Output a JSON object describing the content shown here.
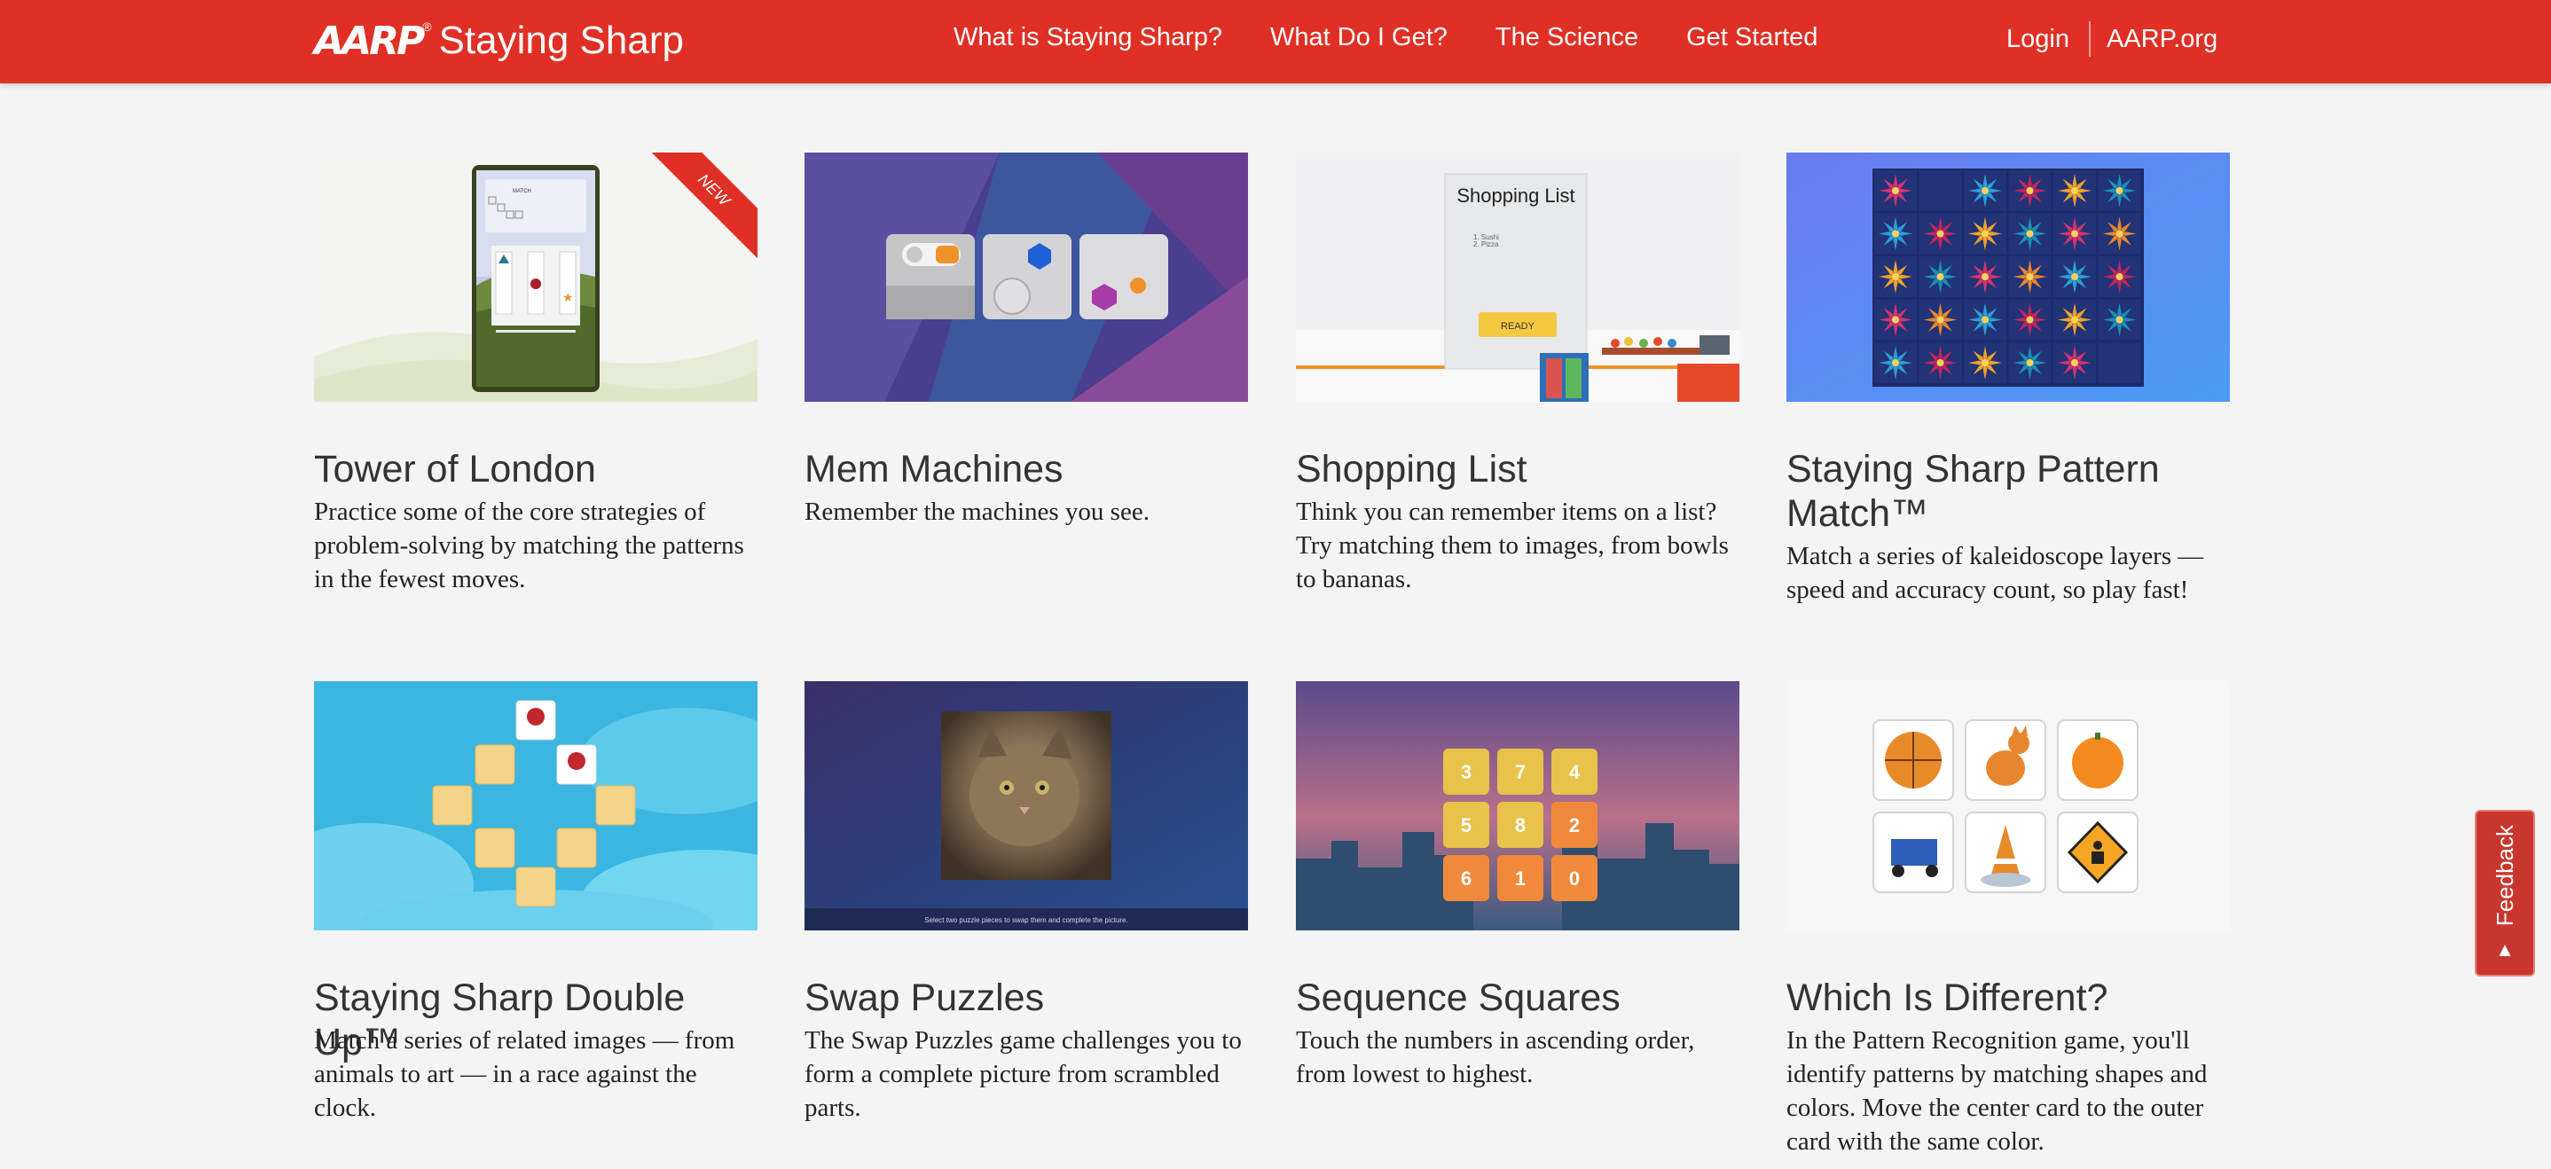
{
  "header": {
    "logo_aarp": "AARP",
    "logo_reg": "®",
    "logo_product": "Staying Sharp",
    "nav": [
      "What is Staying Sharp?",
      "What Do I Get?",
      "The Science",
      "Get Started"
    ],
    "login": "Login",
    "aarp_org": "AARP.org"
  },
  "games": [
    {
      "title": "Tower of London",
      "desc": "Practice some of the core strategies of problem-solving by matching the patterns in the fewest moves.",
      "badge": "NEW"
    },
    {
      "title": "Mem Machines",
      "desc": "Remember the machines you see."
    },
    {
      "title": "Shopping List",
      "desc": "Think you can remember items on a list? Try matching them to images, from bowls to bananas."
    },
    {
      "title": "Staying Sharp Pattern Match™",
      "desc": "Match a series of kaleidoscope layers — speed and accuracy count, so play fast!"
    },
    {
      "title": "Staying Sharp Double Up™",
      "desc": "Match a series of related images — from animals to art — in a race against the clock."
    },
    {
      "title": "Swap Puzzles",
      "desc": "The Swap Puzzles game challenges you to form a complete picture from scrambled parts."
    },
    {
      "title": "Sequence Squares",
      "desc": "Touch the numbers in ascending order, from lowest to highest."
    },
    {
      "title": "Which Is Different?",
      "desc": "In the Pattern Recognition game, you'll identify patterns by matching shapes and colors. Move the center card to the outer card with the same color."
    }
  ],
  "thumbs": {
    "tower": {
      "brand": "AARP",
      "match_label": "MATCH"
    },
    "shopping": {
      "heading": "Shopping List",
      "items": [
        "1. Sushi",
        "2. Pizza"
      ],
      "ready": "READY"
    },
    "swap": {
      "caption": "Select two puzzle pieces to swap them and complete the picture."
    },
    "sequence": {
      "numbers": [
        "3",
        "7",
        "4",
        "5",
        "8",
        "2",
        "6",
        "1",
        "0"
      ]
    }
  },
  "feedback": {
    "label": "Feedback",
    "arrow": "▲"
  }
}
